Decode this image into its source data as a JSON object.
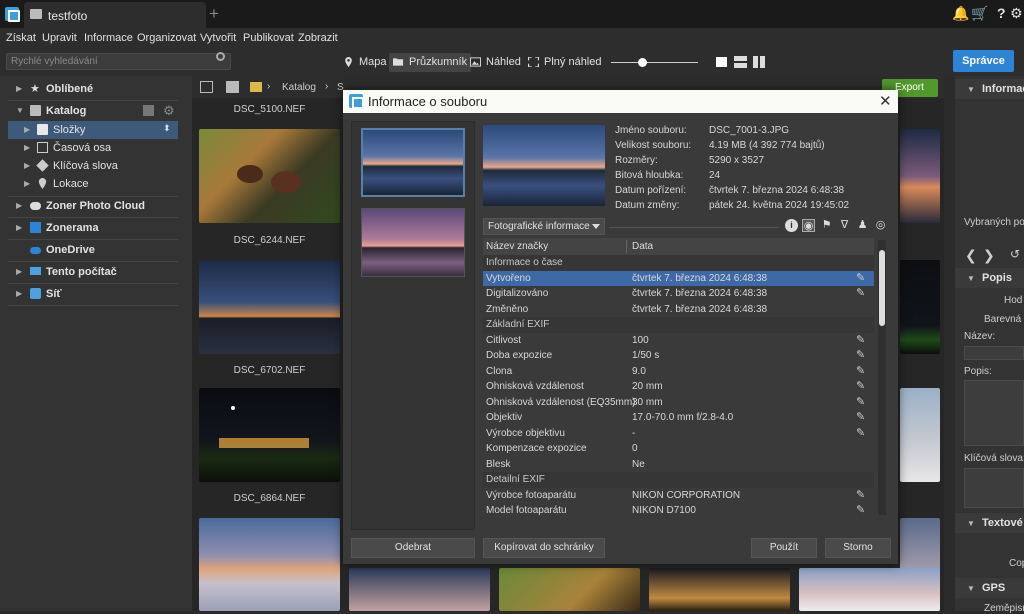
{
  "titlebar": {
    "tab_label": "testfoto",
    "icons": [
      "bell-icon",
      "cart-icon",
      "help-icon",
      "settings-icon"
    ]
  },
  "menu": {
    "items": [
      "Získat",
      "Upravit",
      "Informace",
      "Organizovat",
      "Vytvořit",
      "Publikovat",
      "Zobrazit"
    ]
  },
  "search": {
    "placeholder": "Rychlé vyhledávání"
  },
  "views": {
    "mapa": "Mapa",
    "pruzkumnik": "Průzkumník",
    "nahled": "Náhled",
    "plny_nahled": "Plný náhled"
  },
  "spravce_label": "Správce",
  "tree": {
    "oblibene": "Oblíbené",
    "katalog": "Katalog",
    "slozky": "Složky",
    "casova_osa": "Časová osa",
    "klicova_slova": "Klíčová slova",
    "lokace": "Lokace",
    "zoner_cloud": "Zoner Photo Cloud",
    "zonerama": "Zonerama",
    "onedrive": "OneDrive",
    "tento_pocitac": "Tento počítač",
    "sit": "Síť"
  },
  "browser": {
    "breadcrumb_katalog": "Katalog",
    "breadcrumb_next": "S",
    "export_label": "Export",
    "thumbs": [
      {
        "name": "DSC_5100.NEF"
      },
      {
        "name": "DSC_6244.NEF"
      },
      {
        "name": "DSC_6702.NEF"
      },
      {
        "name": "DSC_6864.NEF"
      }
    ]
  },
  "right_panel": {
    "informace": "Informace",
    "vybranych": "Vybraných pol",
    "popis": "Popis",
    "hodnoceni": "Hod",
    "barevna": "Barevná",
    "nazev": "Název:",
    "popis_field": "Popis:",
    "klicova_slova": "Klíčová slova:",
    "textove": "Textové",
    "cop": "Cop",
    "gps": "GPS",
    "zemepis": "Zeměpisn"
  },
  "dialog": {
    "title": "Informace o souboru",
    "info": [
      {
        "label": "Jméno souboru:",
        "value": "DSC_7001-3.JPG"
      },
      {
        "label": "Velikost souboru:",
        "value": "4.19 MB (4 392 774 bajtů)"
      },
      {
        "label": "Rozměry:",
        "value": "5290 x 3527"
      },
      {
        "label": "Bitová hloubka:",
        "value": "24"
      },
      {
        "label": "Datum pořízení:",
        "value": "čtvrtek 7. března 2024 6:48:38"
      },
      {
        "label": "Datum změny:",
        "value": "pátek 24. května 2024 19:45:02"
      }
    ],
    "select_value": "Fotografické informace",
    "table_header": {
      "key": "Název značky",
      "value": "Data"
    },
    "rows": [
      {
        "k": "Informace o čase",
        "v": "",
        "type": "section"
      },
      {
        "k": "Vytvořeno",
        "v": "čtvrtek 7. března 2024 6:48:38",
        "type": "hl",
        "edit": true
      },
      {
        "k": "Digitalizováno",
        "v": "čtvrtek 7. března 2024 6:48:38",
        "type": "row",
        "edit": true
      },
      {
        "k": "Změněno",
        "v": "čtvrtek 7. března 2024 6:48:38",
        "type": "row",
        "edit": false
      },
      {
        "k": "Základní EXIF",
        "v": "",
        "type": "section"
      },
      {
        "k": "Citlivost",
        "v": "100",
        "type": "row",
        "edit": true
      },
      {
        "k": "Doba expozice",
        "v": "1/50 s",
        "type": "row",
        "edit": true
      },
      {
        "k": "Clona",
        "v": "9.0",
        "type": "row",
        "edit": true
      },
      {
        "k": "Ohnisková vzdálenost",
        "v": "20 mm",
        "type": "row",
        "edit": true
      },
      {
        "k": "Ohnisková vzdálenost (EQ35mm)",
        "v": "30 mm",
        "type": "row",
        "edit": true
      },
      {
        "k": "Objektiv",
        "v": "17.0-70.0 mm f/2.8-4.0",
        "type": "row",
        "edit": true
      },
      {
        "k": "Výrobce objektivu",
        "v": "-",
        "type": "row",
        "edit": true
      },
      {
        "k": "Kompenzace expozice",
        "v": "0",
        "type": "row",
        "edit": false
      },
      {
        "k": "Blesk",
        "v": "Ne",
        "type": "row",
        "edit": false
      },
      {
        "k": "Detailní EXIF",
        "v": "",
        "type": "section"
      },
      {
        "k": "Výrobce fotoaparátu",
        "v": "NIKON CORPORATION",
        "type": "row",
        "edit": true
      },
      {
        "k": "Model fotoaparátu",
        "v": "NIKON D7100",
        "type": "row",
        "edit": true
      }
    ],
    "buttons": {
      "odebrat": "Odebrat",
      "kopirovat": "Kopírovat do schránky",
      "pouzit": "Použít",
      "storno": "Storno"
    }
  }
}
